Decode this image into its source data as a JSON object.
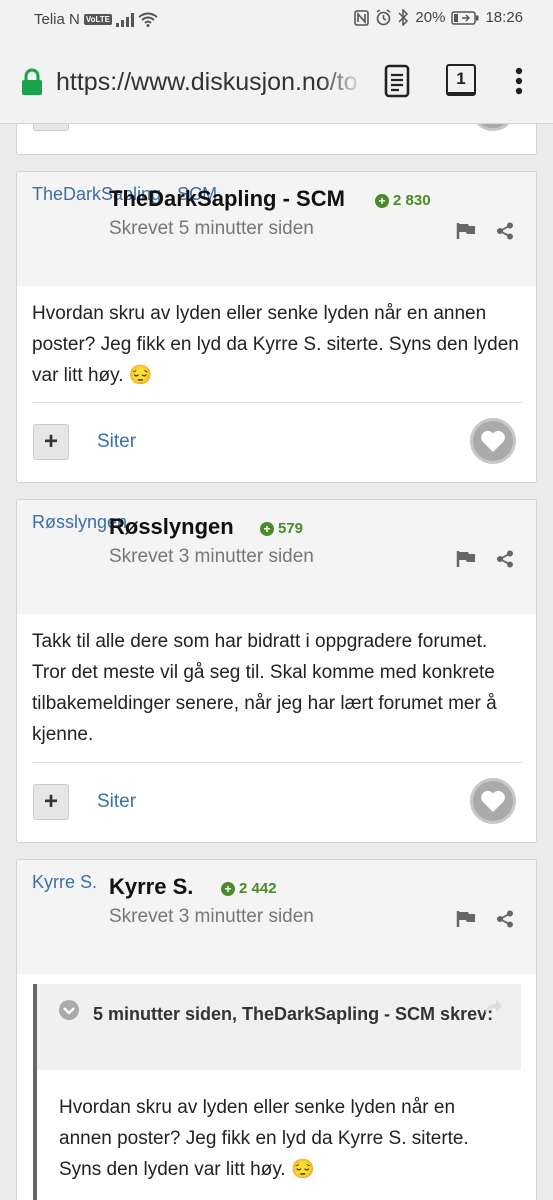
{
  "status": {
    "carrier": "Telia N",
    "volte": "VoLTE",
    "battery": "20%",
    "time": "18:26"
  },
  "browser": {
    "url": "https://www.diskusjon.no/to",
    "tab_count": "1"
  },
  "posts": [
    {
      "avatar_alt": "TheDarkSapling - SCM",
      "author": "TheDarkSapling - SCM",
      "rep": "2 830",
      "time": "Skrevet 5 minutter siden",
      "body": "Hvordan skru av lyden eller senke lyden når en annen poster? Jeg fikk en lyd da Kyrre S. siterte. Syns den lyden var litt høy. 😔",
      "quote_label": "Siter"
    },
    {
      "avatar_alt": "Røsslyngen",
      "author": "Røsslyngen",
      "rep": "579",
      "time": "Skrevet 3 minutter siden",
      "body": "Takk til alle dere som har bidratt i oppgradere forumet. Tror det meste vil gå seg til. Skal komme med konkrete tilbakemeldinger senere, når jeg har lært forumet mer å kjenne.",
      "quote_label": "Siter"
    },
    {
      "avatar_alt": "Kyrre S.",
      "author": "Kyrre S.",
      "rep": "2 442",
      "time": "Skrevet 3 minutter siden",
      "quote": {
        "header": "5 minutter siden, TheDarkSapling - SCM skrev:",
        "text": "Hvordan skru av lyden eller senke lyden når en annen poster? Jeg fikk en lyd da Kyrre S. siterte. Syns den lyden var litt høy. 😔"
      }
    }
  ]
}
